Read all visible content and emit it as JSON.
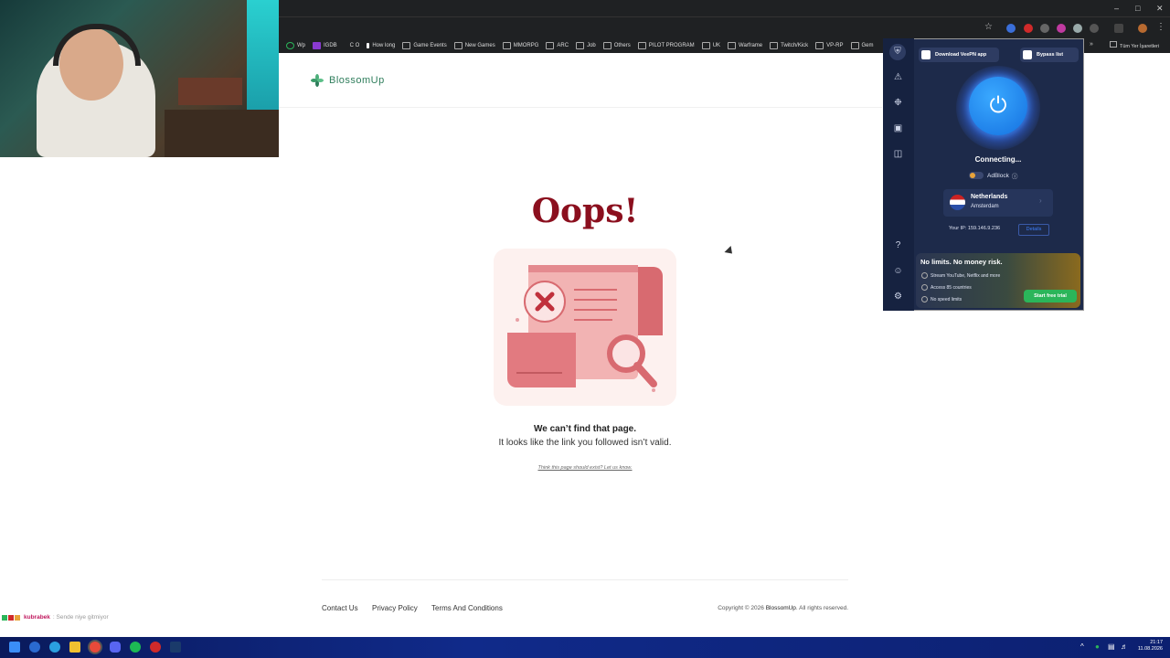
{
  "bookmarks": [
    {
      "label": "Wp"
    },
    {
      "label": "IGDB"
    },
    {
      "label": "C O"
    },
    {
      "label": "How long"
    },
    {
      "label": "Game Events"
    },
    {
      "label": "New Games"
    },
    {
      "label": "MMORPG"
    },
    {
      "label": "ARC"
    },
    {
      "label": "Job"
    },
    {
      "label": "Others"
    },
    {
      "label": "PILOT PROGRAM"
    },
    {
      "label": "UK"
    },
    {
      "label": "Warframe"
    },
    {
      "label": "Twitch/Kick"
    },
    {
      "label": "VP-RP"
    },
    {
      "label": "Gem"
    }
  ],
  "bookmarks_all": "Tüm Yer İşaretleri",
  "site": {
    "brand": "BlossomUp",
    "error_title": "Oops!",
    "message_title": "We can’t find that page.",
    "message_body": "It looks like the link you followed isn’t valid.",
    "report_link": "Think this page should exist? Let us know.",
    "footer_links": [
      "Contact Us",
      "Privacy Policy",
      "Terms And Conditions"
    ],
    "copyright_prefix": "Copyright © 2026",
    "copyright_brand": "BlossomUp",
    "copyright_suffix": ". All rights reserved."
  },
  "vpn": {
    "download_app": "Download VeePN app",
    "bypass_list": "Bypass list",
    "status": "Connecting...",
    "adblock_label": "AdBlock",
    "country": "Netherlands",
    "city": "Amsterdam",
    "ip_label": "Your IP: 159.146.9.236",
    "details": "Details",
    "promo_title": "No limits. No money risk.",
    "perks": [
      "Stream YouTube, Netflix and more",
      "Access 85 countries",
      "No speed limits"
    ],
    "trial_button": "Start free trial"
  },
  "stream_chat": {
    "user": "kubrabek",
    "text": ": Sende niye gitmiyor"
  },
  "taskbar": {
    "time": "21:17",
    "date": "11.08.2026"
  },
  "colors": {
    "error_title": "#8b0f1e",
    "brand_green": "#2e7d5b",
    "vpn_bg": "#1d2a4a",
    "power_blue": "#1470e0",
    "trial_green": "#2bb55a"
  }
}
